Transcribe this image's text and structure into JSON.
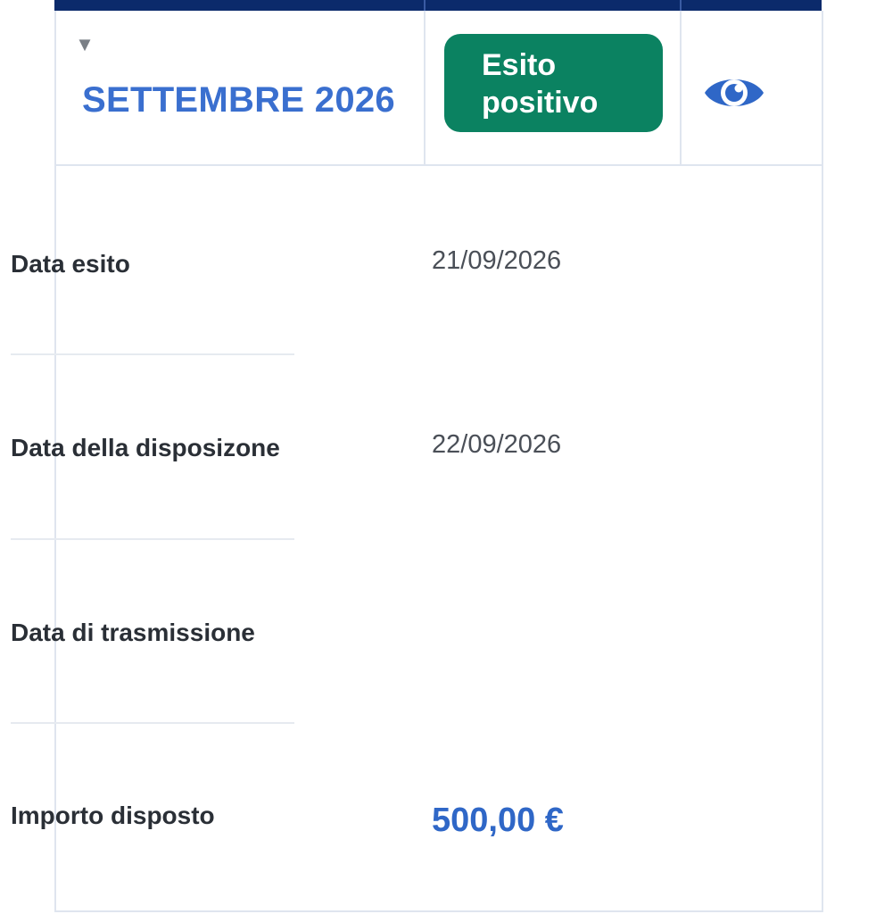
{
  "header": {
    "period": "SETTEMBRE 2026",
    "toggle_icon": "triangle-down-icon",
    "toggle_glyph": "▼",
    "status": "Esito\npositivo",
    "view_icon": "eye-icon"
  },
  "details": [
    {
      "label": "Data esito",
      "value": "21/09/2026"
    },
    {
      "label": "Data della disposizone",
      "value": "22/09/2026"
    },
    {
      "label": "Data di trasmissione",
      "value": ""
    },
    {
      "label": "Importo disposto",
      "value": "500,00 €"
    }
  ],
  "colors": {
    "header_bar": "#0b2a6b",
    "period_text": "#3a6fcf",
    "status_bg": "#0b8261",
    "eye_icon": "#2f67c7",
    "amount_text": "#2f67c7"
  }
}
